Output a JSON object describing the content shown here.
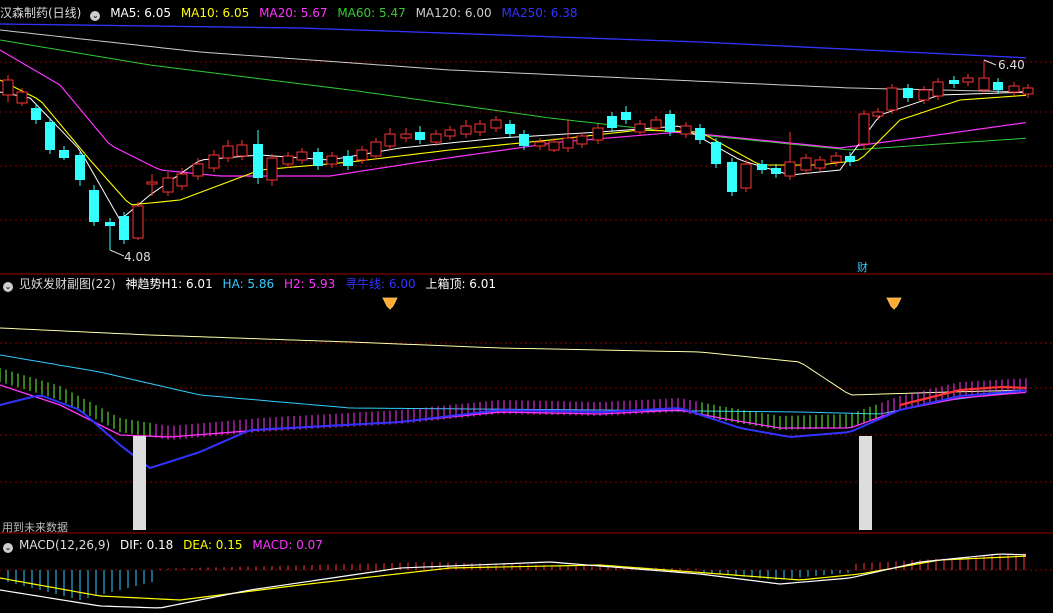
{
  "main_panel": {
    "title": "汉森制药(日线)",
    "indicators": [
      {
        "label": "MA5: 6.05",
        "color": "#ffffff"
      },
      {
        "label": "MA10: 6.05",
        "color": "#ffff00"
      },
      {
        "label": "MA20: 5.67",
        "color": "#ff33ff"
      },
      {
        "label": "MA60: 5.47",
        "color": "#33cc33"
      },
      {
        "label": "MA120: 6.00",
        "color": "#cccccc"
      },
      {
        "label": "MA250: 6.38",
        "color": "#3333ff"
      }
    ],
    "high_label": "6.40",
    "low_label": "4.08",
    "badge": "财"
  },
  "indicator_panel": {
    "title": "见妖发财副图(22)",
    "items": [
      {
        "label": "神趋势H1: 6.01",
        "color": "#ffffff"
      },
      {
        "label": "HA: 5.86",
        "color": "#33ccff"
      },
      {
        "label": "H2: 5.93",
        "color": "#ff33ff"
      },
      {
        "label": "寻牛线: 6.00",
        "color": "#3333ff"
      },
      {
        "label": "上箱顶: 6.01",
        "color": "#ffffff"
      }
    ],
    "warning": "用到未来数据"
  },
  "macd_panel": {
    "title": "MACD(12,26,9)",
    "items": [
      {
        "label": "DIF: 0.18",
        "color": "#ffffff"
      },
      {
        "label": "DEA: 0.15",
        "color": "#ffff00"
      },
      {
        "label": "MACD: 0.07",
        "color": "#ff33ff"
      }
    ]
  },
  "colors": {
    "up": "#ff3333",
    "down": "#33ffff",
    "grid": "#8b0000",
    "divider": "#9b0000",
    "gem": "#ffaa33"
  }
}
